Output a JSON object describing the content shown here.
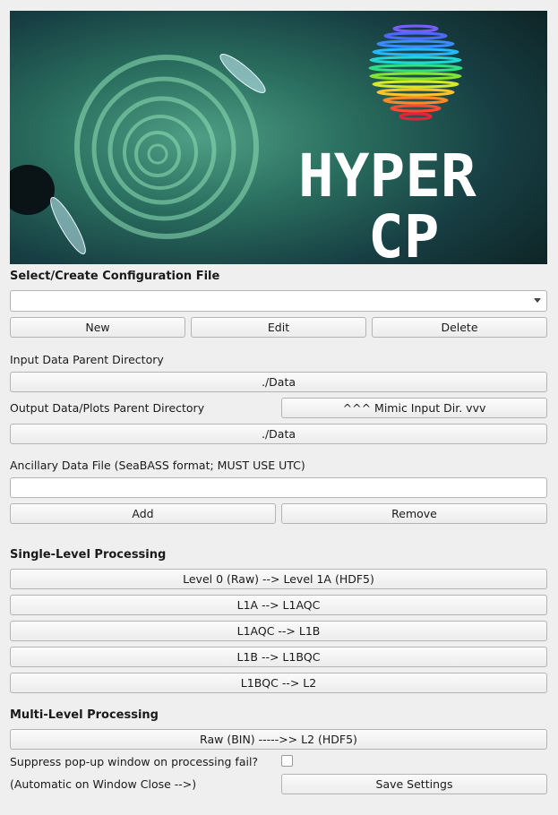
{
  "banner": {
    "logo_line1": "HYPER",
    "logo_line2": "CP"
  },
  "config": {
    "title": "Select/Create Configuration File",
    "selected": "",
    "new_label": "New",
    "edit_label": "Edit",
    "delete_label": "Delete"
  },
  "input": {
    "label": "Input Data Parent Directory",
    "path": "./Data"
  },
  "output": {
    "label": "Output Data/Plots Parent Directory",
    "mimic_label": "^^^ Mimic Input Dir. vvv",
    "path": "./Data"
  },
  "ancillary": {
    "label": "Ancillary Data File (SeaBASS format; MUST USE UTC)",
    "value": "",
    "add_label": "Add",
    "remove_label": "Remove"
  },
  "single": {
    "title": "Single-Level Processing",
    "buttons": [
      "Level 0 (Raw) --> Level 1A (HDF5)",
      "L1A --> L1AQC",
      "L1AQC --> L1B",
      "L1B --> L1BQC",
      "L1BQC --> L2"
    ]
  },
  "multi": {
    "title": "Multi-Level Processing",
    "button": "Raw (BIN) ----->> L2 (HDF5)",
    "suppress_label": "Suppress pop-up window on processing fail?",
    "suppress_checked": false,
    "auto_label": "(Automatic on Window Close -->)",
    "save_label": "Save Settings"
  }
}
